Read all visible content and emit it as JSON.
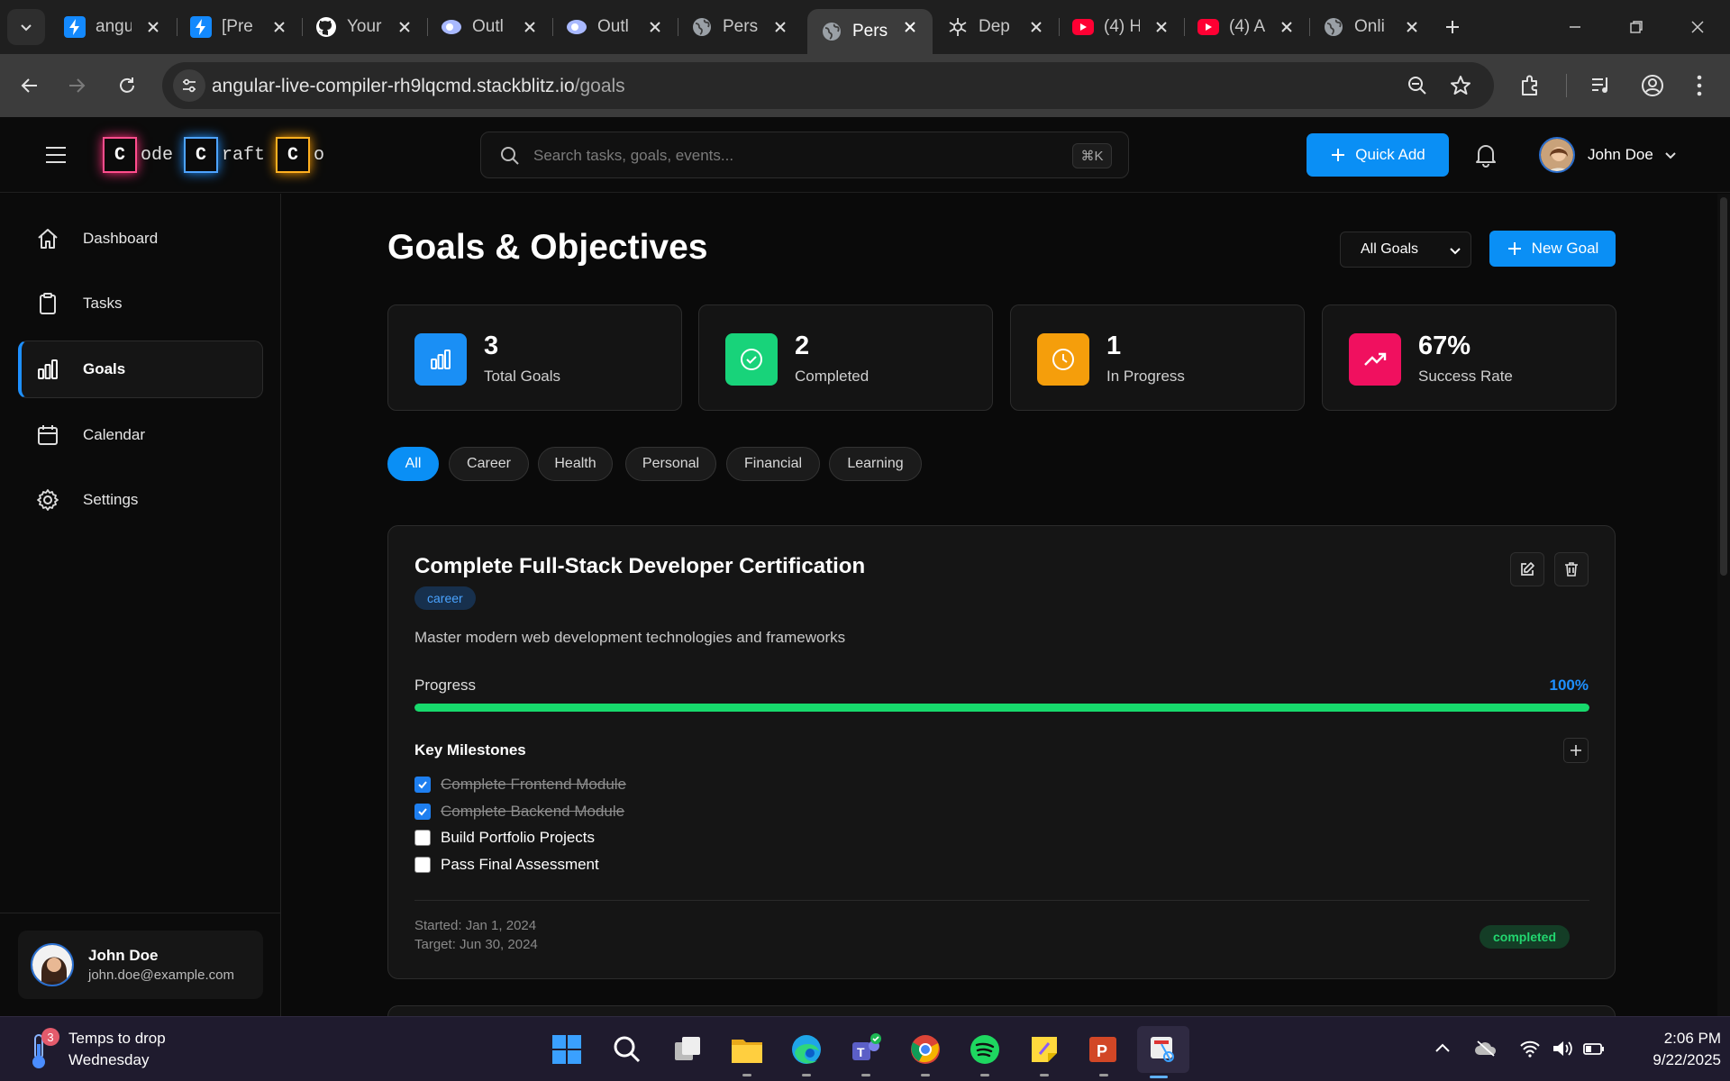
{
  "browser": {
    "tabs": [
      {
        "label": "angu",
        "icon": "stackblitz-icon"
      },
      {
        "label": "[Pre",
        "icon": "stackblitz-icon"
      },
      {
        "label": "Your",
        "icon": "github-icon"
      },
      {
        "label": "Outl",
        "icon": "outlier-icon"
      },
      {
        "label": "Outl",
        "icon": "outlier-icon"
      },
      {
        "label": "Pers",
        "icon": "globe-icon"
      },
      {
        "label": "Pers",
        "icon": "globe-icon",
        "active": true
      },
      {
        "label": "Dep",
        "icon": "openai-icon"
      },
      {
        "label": "(4) H",
        "icon": "youtube-icon"
      },
      {
        "label": "(4) A",
        "icon": "youtube-icon"
      },
      {
        "label": "Onli",
        "icon": "globe-icon"
      }
    ],
    "url_host": "angular-live-compiler-rh9lqcmd.stackblitz.io",
    "url_path": "/goals"
  },
  "app": {
    "logo": {
      "letter": "C",
      "part1": "ode",
      "part2": "raft",
      "part3": "o"
    },
    "search_placeholder": "Search tasks, goals, events...",
    "search_shortcut": "⌘K",
    "quick_add_label": "Quick Add",
    "user_name": "John Doe"
  },
  "sidebar": {
    "items": [
      {
        "label": "Dashboard",
        "icon": "home-icon"
      },
      {
        "label": "Tasks",
        "icon": "clipboard-icon"
      },
      {
        "label": "Goals",
        "icon": "bar-chart-icon",
        "active": true
      },
      {
        "label": "Calendar",
        "icon": "calendar-icon"
      },
      {
        "label": "Settings",
        "icon": "gear-icon"
      }
    ],
    "user": {
      "name": "John Doe",
      "email": "john.doe@example.com"
    }
  },
  "main": {
    "title": "Goals & Objectives",
    "filter_value": "All Goals",
    "new_goal_label": "New Goal",
    "stats": [
      {
        "value": "3",
        "label": "Total Goals",
        "color": "#1a8ff5",
        "icon": "bar-chart-icon"
      },
      {
        "value": "2",
        "label": "Completed",
        "color": "#18d37a",
        "icon": "check-circle-icon"
      },
      {
        "value": "1",
        "label": "In Progress",
        "color": "#f59e0b",
        "icon": "clock-icon"
      },
      {
        "value": "67%",
        "label": "Success Rate",
        "color": "#f0105f",
        "icon": "trending-up-icon"
      }
    ],
    "categories": [
      "All",
      "Career",
      "Health",
      "Personal",
      "Financial",
      "Learning"
    ],
    "active_category": "All",
    "goal": {
      "title": "Complete Full-Stack Developer Certification",
      "category": "career",
      "description": "Master modern web development technologies and frameworks",
      "progress_label": "Progress",
      "progress_text": "100%",
      "progress": 1.0,
      "milestones_title": "Key Milestones",
      "milestones": [
        {
          "text": "Complete Frontend Module",
          "done": true
        },
        {
          "text": "Complete Backend Module",
          "done": true
        },
        {
          "text": "Build Portfolio Projects",
          "done": false
        },
        {
          "text": "Pass Final Assessment",
          "done": false
        }
      ],
      "started": "Started: Jan 1, 2024",
      "target": "Target: Jun 30, 2024",
      "status": "completed"
    }
  },
  "taskbar": {
    "weather_badge": "3",
    "weather_line1": "Temps to drop",
    "weather_line2": "Wednesday",
    "apps": [
      "windows-start-icon",
      "search-icon",
      "task-view-icon",
      "file-explorer-icon",
      "edge-icon",
      "teams-icon",
      "chrome-icon",
      "spotify-icon",
      "sticky-notes-icon",
      "powerpoint-icon",
      "snipping-tool-icon"
    ],
    "time": "2:06 PM",
    "date": "9/22/2025"
  }
}
